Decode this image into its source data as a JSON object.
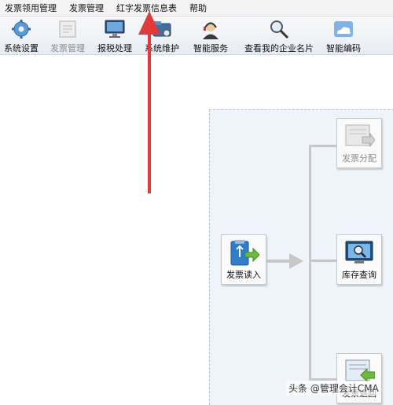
{
  "menu": [
    {
      "label": "发票领用管理"
    },
    {
      "label": "发票管理"
    },
    {
      "label": "红字发票信息表"
    },
    {
      "label": "帮助"
    }
  ],
  "toolbar": [
    {
      "label": "系统设置",
      "icon": "gear-icon",
      "enabled": true
    },
    {
      "label": "发票管理",
      "icon": "invoice-icon",
      "enabled": false
    },
    {
      "label": "报税处理",
      "icon": "monitor-icon",
      "enabled": true
    },
    {
      "label": "系统维护",
      "icon": "maintenance-icon",
      "enabled": true
    },
    {
      "label": "智能服务",
      "icon": "headset-icon",
      "enabled": true
    },
    {
      "label": "查看我的企业名片",
      "icon": "magnifier-icon",
      "enabled": true
    },
    {
      "label": "智能编码",
      "icon": "cloud-icon",
      "enabled": true
    }
  ],
  "workflow": {
    "read": {
      "label": "发票读入",
      "icon": "usb-import-icon"
    },
    "distribute": {
      "label": "发票分配",
      "icon": "invoice-distribute-icon",
      "enabled": false
    },
    "inventory": {
      "label": "库存查询",
      "icon": "inventory-search-icon"
    },
    "return": {
      "label": "发票退回",
      "icon": "invoice-return-icon"
    }
  },
  "watermark": "头条 @管理会计CMA",
  "colors": {
    "annotation": "#e03a3a",
    "panel": "#eff4fa",
    "connector": "#c7c7c7"
  }
}
